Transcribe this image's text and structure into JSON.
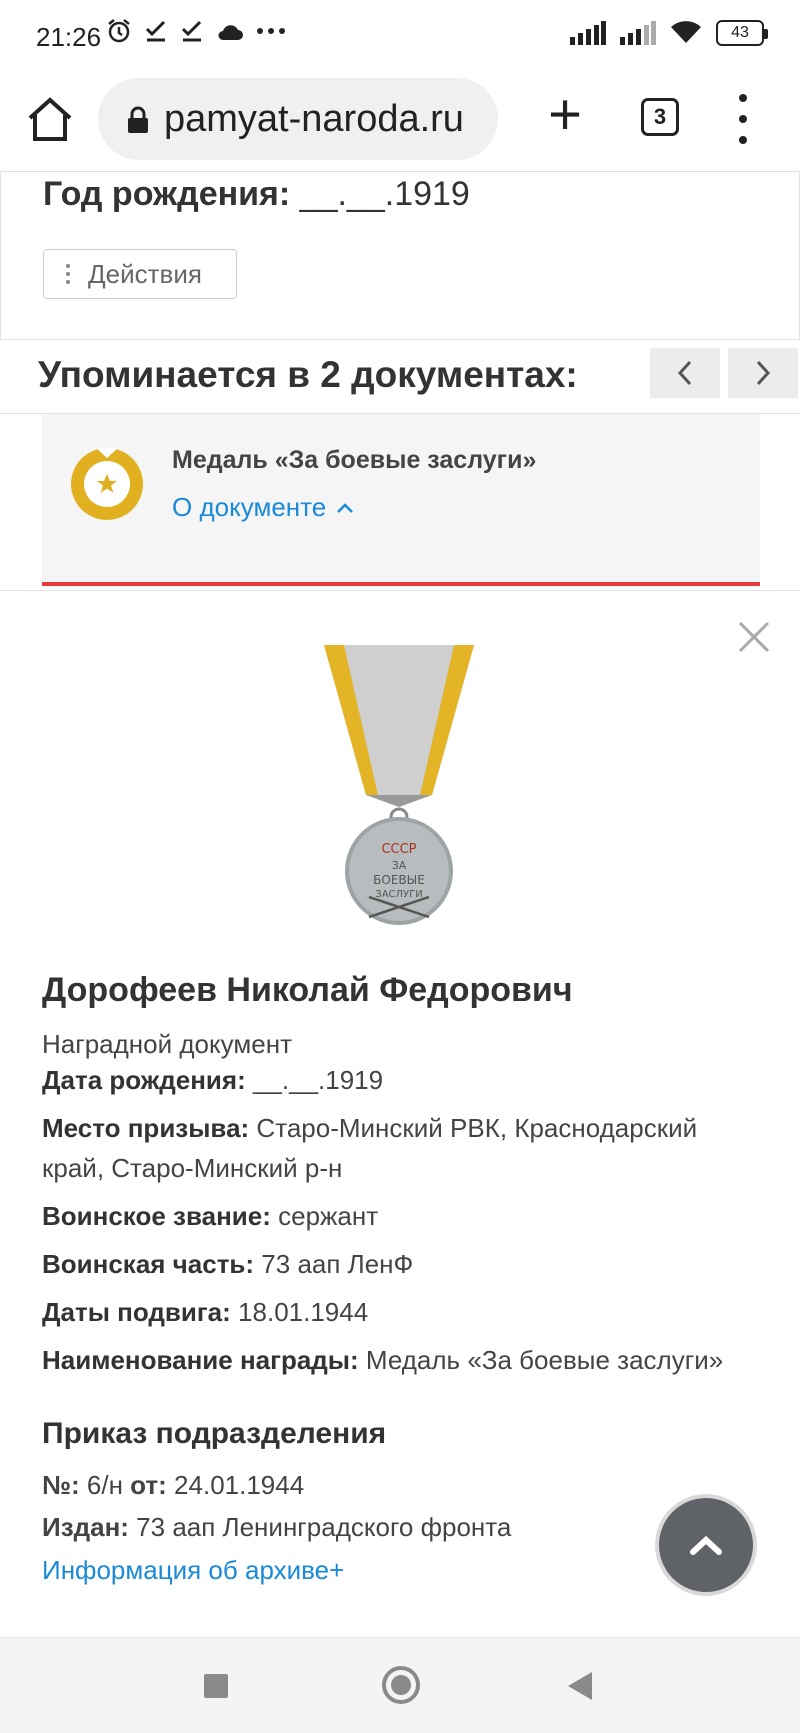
{
  "status_bar": {
    "time": "21:26",
    "battery": "43",
    "left_icons": [
      "alarm-icon",
      "check-icon",
      "check-icon",
      "cloud-icon",
      "more-icon"
    ],
    "right_icons": [
      "signal-icon",
      "signal-icon",
      "wifi-icon",
      "battery-icon"
    ]
  },
  "browser": {
    "url": "pamyat-naroda.ru",
    "tab_count": "3"
  },
  "top_card": {
    "birth_label": "Год рождения:",
    "birth_value": "__.__.1919",
    "actions_label": "Действия"
  },
  "mentions": {
    "title": "Упоминается в 2 документах:",
    "prev": "‹",
    "next": "›"
  },
  "document_card": {
    "title": "Медаль «За боевые заслуги»",
    "link": "О документе"
  },
  "detail": {
    "person_name": "Дорофеев Николай Федорович",
    "doc_type": "Наградной документ",
    "fields": [
      {
        "label": "Дата рождения:",
        "value": "__.__.1919"
      },
      {
        "label": "Место призыва:",
        "value": "Старо-Минский РВК, Краснодарский край, Старо-Минский р-н"
      },
      {
        "label": "Воинское звание:",
        "value": "сержант"
      },
      {
        "label": "Воинская часть:",
        "value": "73 аап ЛенФ"
      },
      {
        "label": "Даты подвига:",
        "value": "18.01.1944"
      },
      {
        "label": "Наименование награды:",
        "value": "Медаль «За боевые заслуги»"
      }
    ],
    "order": {
      "title": "Приказ подразделения",
      "number_label": "№:",
      "number_value": "6/н",
      "date_label": "от:",
      "date_value": "24.01.1944",
      "issued_label": "Издан:",
      "issued_value": "73 аап Ленинградского фронта"
    },
    "archive_link": "Информация об архиве+",
    "medal_text": [
      "СССР",
      "ЗА",
      "БОЕВЫЕ",
      "ЗАСЛУГИ"
    ]
  },
  "colors": {
    "accent_red": "#e53a3f",
    "link_blue": "#1a8ad8",
    "medal_gold": "#e0b020"
  }
}
